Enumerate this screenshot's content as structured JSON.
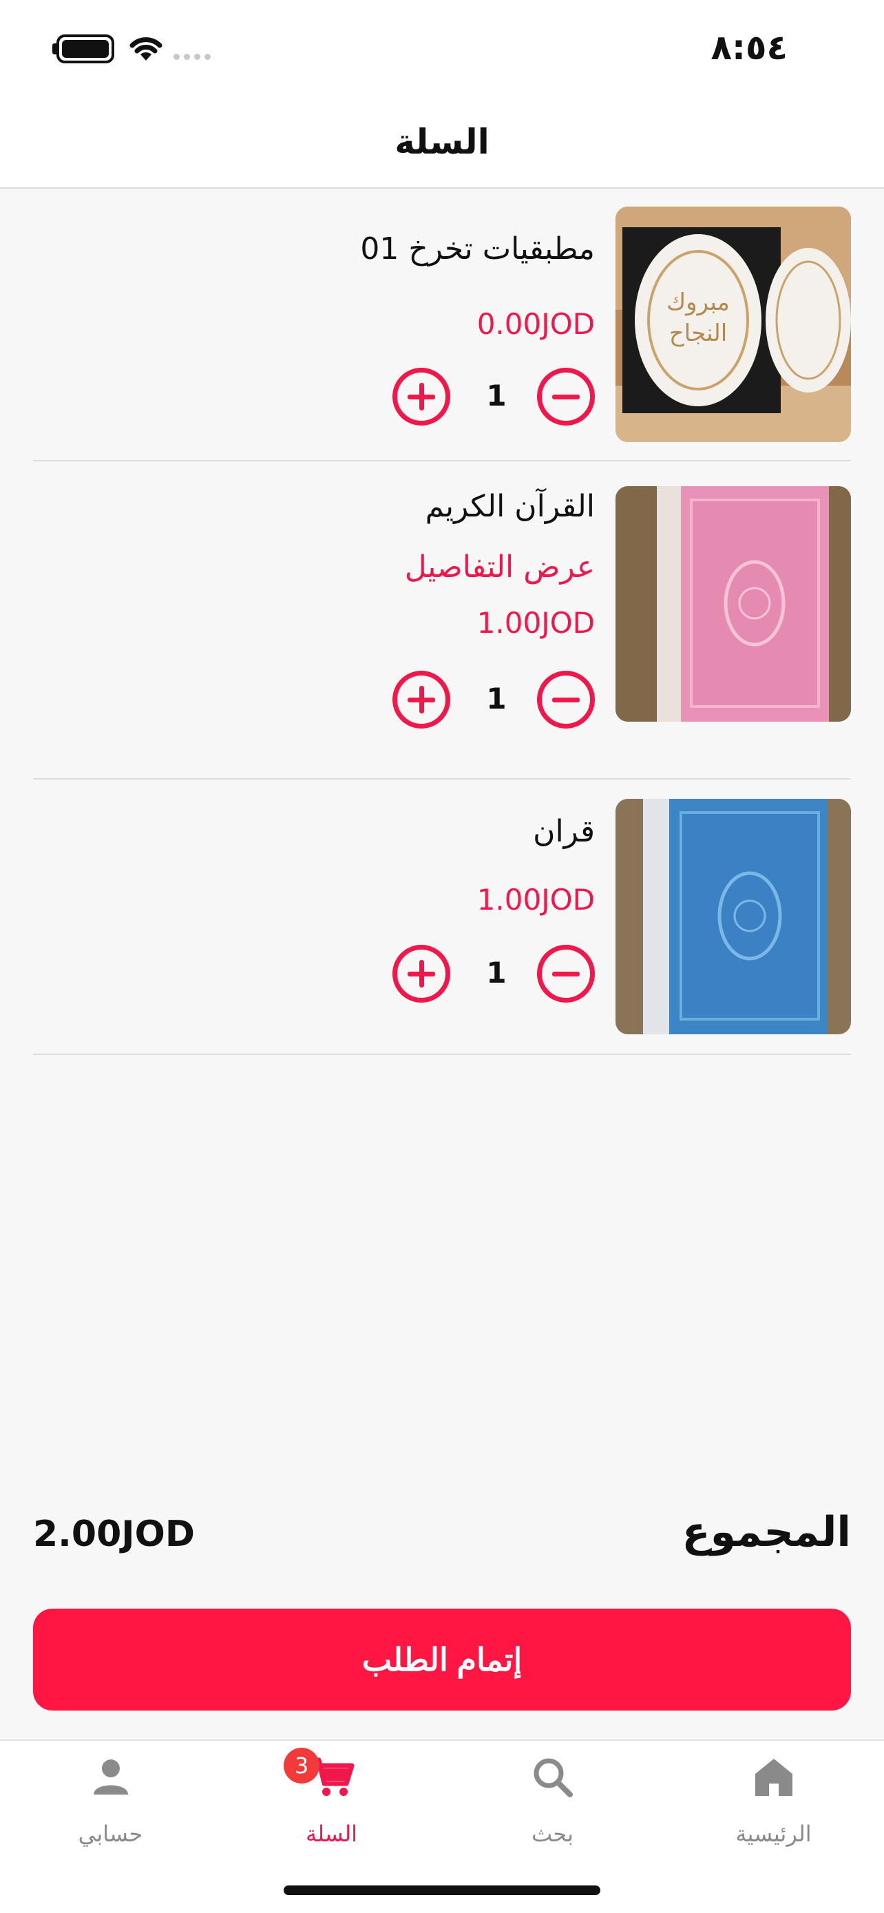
{
  "status_bar": {
    "time": "٨:٥٤"
  },
  "nav": {
    "title": "السلة"
  },
  "cart": {
    "items": [
      {
        "name": "مطبقيات تخرخ 01",
        "details_link": "",
        "price": "0.00JOD",
        "quantity": "1",
        "image": "graduation-favors-photo"
      },
      {
        "name": "القرآن الكريم",
        "details_link": "عرض التفاصيل",
        "price": "1.00JOD",
        "quantity": "1",
        "image": "pink-quran-photo"
      },
      {
        "name": "قران",
        "details_link": "",
        "price": "1.00JOD",
        "quantity": "1",
        "image": "blue-quran-photo"
      }
    ]
  },
  "total": {
    "label": "المجموع",
    "value": "2.00JOD"
  },
  "checkout": {
    "label": "إتمام الطلب"
  },
  "tabs": [
    {
      "label": "الرئيسية",
      "icon": "home-icon"
    },
    {
      "label": "بحث",
      "icon": "search-icon"
    },
    {
      "label": "السلة",
      "icon": "cart-icon",
      "active": true,
      "badge": "3"
    },
    {
      "label": "حسابي",
      "icon": "person-icon"
    }
  ],
  "colors": {
    "accent": "#f0184a",
    "button": "#ff1744",
    "badge": "#f33a3a"
  }
}
